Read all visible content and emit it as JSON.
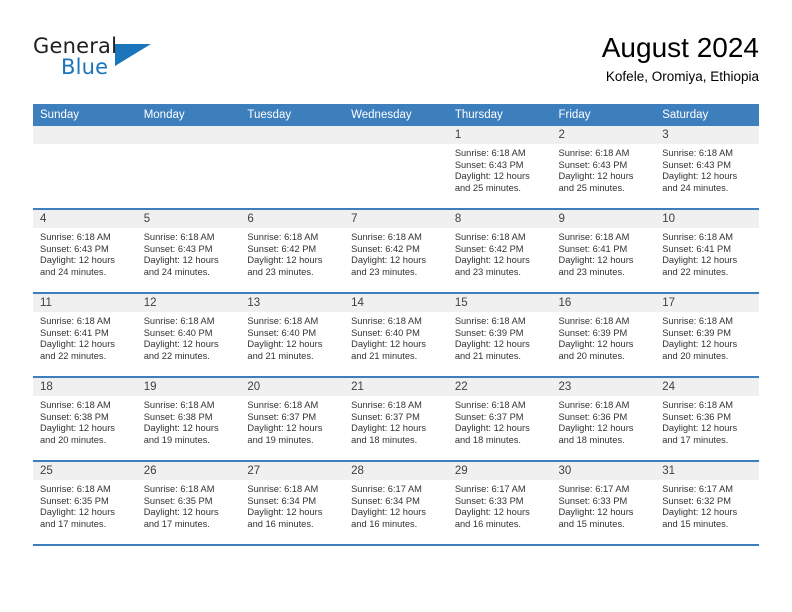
{
  "brand": {
    "word1": "General",
    "word2": "Blue",
    "logo_color": "#1b75bb"
  },
  "header": {
    "title": "August 2024",
    "location": "Kofele, Oromiya, Ethiopia"
  },
  "theme": {
    "header_row_bg": "#3d7ebd",
    "daynum_bg": "#f0f0f0",
    "row_divider": "#3d7ebd"
  },
  "weekdays": [
    "Sunday",
    "Monday",
    "Tuesday",
    "Wednesday",
    "Thursday",
    "Friday",
    "Saturday"
  ],
  "weeks": [
    [
      {
        "day": "",
        "sunrise": "",
        "sunset": "",
        "daylight1": "",
        "daylight2": ""
      },
      {
        "day": "",
        "sunrise": "",
        "sunset": "",
        "daylight1": "",
        "daylight2": ""
      },
      {
        "day": "",
        "sunrise": "",
        "sunset": "",
        "daylight1": "",
        "daylight2": ""
      },
      {
        "day": "",
        "sunrise": "",
        "sunset": "",
        "daylight1": "",
        "daylight2": ""
      },
      {
        "day": "1",
        "sunrise": "Sunrise: 6:18 AM",
        "sunset": "Sunset: 6:43 PM",
        "daylight1": "Daylight: 12 hours",
        "daylight2": "and 25 minutes."
      },
      {
        "day": "2",
        "sunrise": "Sunrise: 6:18 AM",
        "sunset": "Sunset: 6:43 PM",
        "daylight1": "Daylight: 12 hours",
        "daylight2": "and 25 minutes."
      },
      {
        "day": "3",
        "sunrise": "Sunrise: 6:18 AM",
        "sunset": "Sunset: 6:43 PM",
        "daylight1": "Daylight: 12 hours",
        "daylight2": "and 24 minutes."
      }
    ],
    [
      {
        "day": "4",
        "sunrise": "Sunrise: 6:18 AM",
        "sunset": "Sunset: 6:43 PM",
        "daylight1": "Daylight: 12 hours",
        "daylight2": "and 24 minutes."
      },
      {
        "day": "5",
        "sunrise": "Sunrise: 6:18 AM",
        "sunset": "Sunset: 6:43 PM",
        "daylight1": "Daylight: 12 hours",
        "daylight2": "and 24 minutes."
      },
      {
        "day": "6",
        "sunrise": "Sunrise: 6:18 AM",
        "sunset": "Sunset: 6:42 PM",
        "daylight1": "Daylight: 12 hours",
        "daylight2": "and 23 minutes."
      },
      {
        "day": "7",
        "sunrise": "Sunrise: 6:18 AM",
        "sunset": "Sunset: 6:42 PM",
        "daylight1": "Daylight: 12 hours",
        "daylight2": "and 23 minutes."
      },
      {
        "day": "8",
        "sunrise": "Sunrise: 6:18 AM",
        "sunset": "Sunset: 6:42 PM",
        "daylight1": "Daylight: 12 hours",
        "daylight2": "and 23 minutes."
      },
      {
        "day": "9",
        "sunrise": "Sunrise: 6:18 AM",
        "sunset": "Sunset: 6:41 PM",
        "daylight1": "Daylight: 12 hours",
        "daylight2": "and 23 minutes."
      },
      {
        "day": "10",
        "sunrise": "Sunrise: 6:18 AM",
        "sunset": "Sunset: 6:41 PM",
        "daylight1": "Daylight: 12 hours",
        "daylight2": "and 22 minutes."
      }
    ],
    [
      {
        "day": "11",
        "sunrise": "Sunrise: 6:18 AM",
        "sunset": "Sunset: 6:41 PM",
        "daylight1": "Daylight: 12 hours",
        "daylight2": "and 22 minutes."
      },
      {
        "day": "12",
        "sunrise": "Sunrise: 6:18 AM",
        "sunset": "Sunset: 6:40 PM",
        "daylight1": "Daylight: 12 hours",
        "daylight2": "and 22 minutes."
      },
      {
        "day": "13",
        "sunrise": "Sunrise: 6:18 AM",
        "sunset": "Sunset: 6:40 PM",
        "daylight1": "Daylight: 12 hours",
        "daylight2": "and 21 minutes."
      },
      {
        "day": "14",
        "sunrise": "Sunrise: 6:18 AM",
        "sunset": "Sunset: 6:40 PM",
        "daylight1": "Daylight: 12 hours",
        "daylight2": "and 21 minutes."
      },
      {
        "day": "15",
        "sunrise": "Sunrise: 6:18 AM",
        "sunset": "Sunset: 6:39 PM",
        "daylight1": "Daylight: 12 hours",
        "daylight2": "and 21 minutes."
      },
      {
        "day": "16",
        "sunrise": "Sunrise: 6:18 AM",
        "sunset": "Sunset: 6:39 PM",
        "daylight1": "Daylight: 12 hours",
        "daylight2": "and 20 minutes."
      },
      {
        "day": "17",
        "sunrise": "Sunrise: 6:18 AM",
        "sunset": "Sunset: 6:39 PM",
        "daylight1": "Daylight: 12 hours",
        "daylight2": "and 20 minutes."
      }
    ],
    [
      {
        "day": "18",
        "sunrise": "Sunrise: 6:18 AM",
        "sunset": "Sunset: 6:38 PM",
        "daylight1": "Daylight: 12 hours",
        "daylight2": "and 20 minutes."
      },
      {
        "day": "19",
        "sunrise": "Sunrise: 6:18 AM",
        "sunset": "Sunset: 6:38 PM",
        "daylight1": "Daylight: 12 hours",
        "daylight2": "and 19 minutes."
      },
      {
        "day": "20",
        "sunrise": "Sunrise: 6:18 AM",
        "sunset": "Sunset: 6:37 PM",
        "daylight1": "Daylight: 12 hours",
        "daylight2": "and 19 minutes."
      },
      {
        "day": "21",
        "sunrise": "Sunrise: 6:18 AM",
        "sunset": "Sunset: 6:37 PM",
        "daylight1": "Daylight: 12 hours",
        "daylight2": "and 18 minutes."
      },
      {
        "day": "22",
        "sunrise": "Sunrise: 6:18 AM",
        "sunset": "Sunset: 6:37 PM",
        "daylight1": "Daylight: 12 hours",
        "daylight2": "and 18 minutes."
      },
      {
        "day": "23",
        "sunrise": "Sunrise: 6:18 AM",
        "sunset": "Sunset: 6:36 PM",
        "daylight1": "Daylight: 12 hours",
        "daylight2": "and 18 minutes."
      },
      {
        "day": "24",
        "sunrise": "Sunrise: 6:18 AM",
        "sunset": "Sunset: 6:36 PM",
        "daylight1": "Daylight: 12 hours",
        "daylight2": "and 17 minutes."
      }
    ],
    [
      {
        "day": "25",
        "sunrise": "Sunrise: 6:18 AM",
        "sunset": "Sunset: 6:35 PM",
        "daylight1": "Daylight: 12 hours",
        "daylight2": "and 17 minutes."
      },
      {
        "day": "26",
        "sunrise": "Sunrise: 6:18 AM",
        "sunset": "Sunset: 6:35 PM",
        "daylight1": "Daylight: 12 hours",
        "daylight2": "and 17 minutes."
      },
      {
        "day": "27",
        "sunrise": "Sunrise: 6:18 AM",
        "sunset": "Sunset: 6:34 PM",
        "daylight1": "Daylight: 12 hours",
        "daylight2": "and 16 minutes."
      },
      {
        "day": "28",
        "sunrise": "Sunrise: 6:17 AM",
        "sunset": "Sunset: 6:34 PM",
        "daylight1": "Daylight: 12 hours",
        "daylight2": "and 16 minutes."
      },
      {
        "day": "29",
        "sunrise": "Sunrise: 6:17 AM",
        "sunset": "Sunset: 6:33 PM",
        "daylight1": "Daylight: 12 hours",
        "daylight2": "and 16 minutes."
      },
      {
        "day": "30",
        "sunrise": "Sunrise: 6:17 AM",
        "sunset": "Sunset: 6:33 PM",
        "daylight1": "Daylight: 12 hours",
        "daylight2": "and 15 minutes."
      },
      {
        "day": "31",
        "sunrise": "Sunrise: 6:17 AM",
        "sunset": "Sunset: 6:32 PM",
        "daylight1": "Daylight: 12 hours",
        "daylight2": "and 15 minutes."
      }
    ]
  ]
}
